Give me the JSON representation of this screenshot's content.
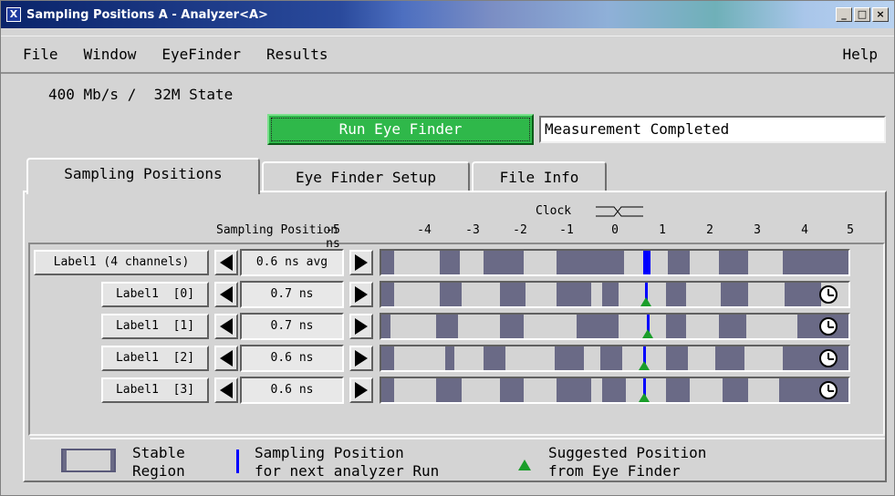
{
  "window": {
    "title": "Sampling Positions A - Analyzer<A>",
    "app_icon": "X",
    "buttons": [
      "_",
      "□",
      "×"
    ]
  },
  "menu": {
    "items": [
      "File",
      "Window",
      "EyeFinder",
      "Results"
    ],
    "help": "Help"
  },
  "state_text": "400 Mb/s /  32M State",
  "run_button": "Run Eye Finder",
  "status": "Measurement Completed",
  "tabs": [
    "Sampling Positions",
    "Eye Finder Setup",
    "File Info"
  ],
  "header": {
    "sampling_position": "Sampling Position",
    "clock": "Clock",
    "ticks": [
      "-5 ns",
      "-4",
      "-3",
      "-2",
      "-1",
      "0",
      "1",
      "2",
      "3",
      "4",
      "5"
    ]
  },
  "rows": [
    {
      "label": "Label1 (4 channels)",
      "value": "0.6 ns avg"
    },
    {
      "label": "Label1  [0]",
      "value": "0.7 ns"
    },
    {
      "label": "Label1  [1]",
      "value": "0.7 ns"
    },
    {
      "label": "Label1  [2]",
      "value": "0.6 ns"
    },
    {
      "label": "Label1  [3]",
      "value": "0.6 ns"
    }
  ],
  "legend": {
    "stable": [
      "Stable",
      "Region"
    ],
    "sampling": [
      "Sampling Position",
      "for next analyzer Run"
    ],
    "suggested": [
      "Suggested Position",
      "from Eye Finder"
    ]
  },
  "colors": {
    "run_button": "#2fb84a",
    "stable_region": "#6a6a86",
    "sampling_line": "#0000ff",
    "suggested_marker": "#1a9e2a"
  },
  "icons": {
    "left_arrow": "left-triangle",
    "right_arrow": "right-triangle",
    "clock": "clock-icon"
  }
}
